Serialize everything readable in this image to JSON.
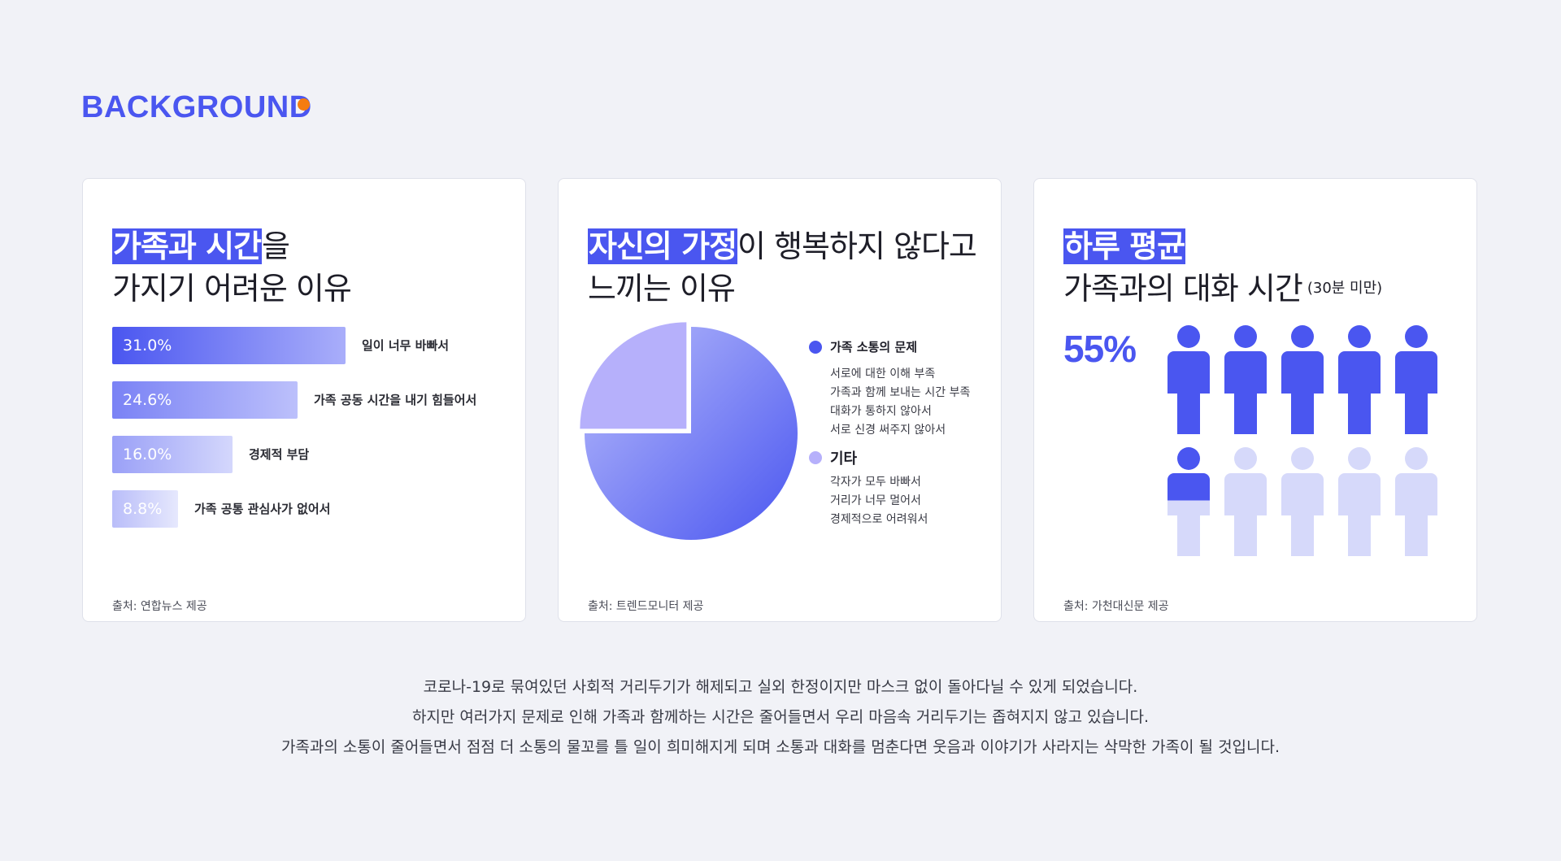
{
  "section_title": "BACKGROUND",
  "colors": {
    "accent": "#4a56f0",
    "accent_light": "#b6b0fb",
    "person_light": "#d6d9fa",
    "dot_orange": "#f57c10",
    "background": "#f1f2f7"
  },
  "cards": [
    {
      "title_highlight": "가족과 시간",
      "title_rest_line1": "을",
      "title_line2": "가지기 어려운 이유",
      "source": "출처: 연합뉴스 제공"
    },
    {
      "title_highlight": "자신의 가정",
      "title_rest_line1": "이 행복하지 않다고",
      "title_line2": "느끼는 이유",
      "source": "출처: 트렌드모니터 제공"
    },
    {
      "title_highlight": "하루 평균",
      "title_rest_line1": "",
      "title_line2": "가족과의 대화 시간",
      "title_note": "(30분 미만)",
      "source": "출처: 가천대신문 제공"
    }
  ],
  "chart_data": [
    {
      "type": "bar",
      "categories": [
        "일이 너무 바빠서",
        "가족 공동 시간을 내기 힘들어서",
        "경제적 부담",
        "가족 공통 관심사가 없어서"
      ],
      "values": [
        31.0,
        24.6,
        16.0,
        8.8
      ],
      "value_labels": [
        "31.0%",
        "24.6%",
        "16.0%",
        "8.8%"
      ],
      "unit": "%"
    },
    {
      "type": "pie",
      "slices": [
        {
          "name": "가족 소통의 문제",
          "value": 75,
          "color": "#4a56f0",
          "details": [
            "서로에 대한 이해 부족",
            "가족과 함께 보내는 시간 부족",
            "대화가 통하지 않아서",
            "서로 신경 써주지 않아서"
          ]
        },
        {
          "name": "기타",
          "value": 25,
          "color": "#b6b0fb",
          "details": [
            "각자가 모두 바빠서",
            "거리가 너무 멀어서",
            "경제적으로 어려워서"
          ]
        }
      ]
    },
    {
      "type": "pictogram",
      "value": 55,
      "value_label": "55%",
      "total_icons": 10,
      "filled_icons": 5.5,
      "icon": "person-icon"
    }
  ],
  "footer_lines": [
    "코로나-19로 묶여있던 사회적 거리두기가 해제되고 실외 한정이지만 마스크 없이 돌아다닐 수 있게 되었습니다.",
    "하지만 여러가지 문제로 인해 가족과 함께하는 시간은 줄어들면서 우리 마음속 거리두기는 좁혀지지 않고 있습니다.",
    "가족과의 소통이 줄어들면서 점점 더 소통의 물꼬를 틀 일이 희미해지게 되며 소통과 대화를 멈춘다면 웃음과 이야기가 사라지는 삭막한 가족이 될 것입니다."
  ]
}
